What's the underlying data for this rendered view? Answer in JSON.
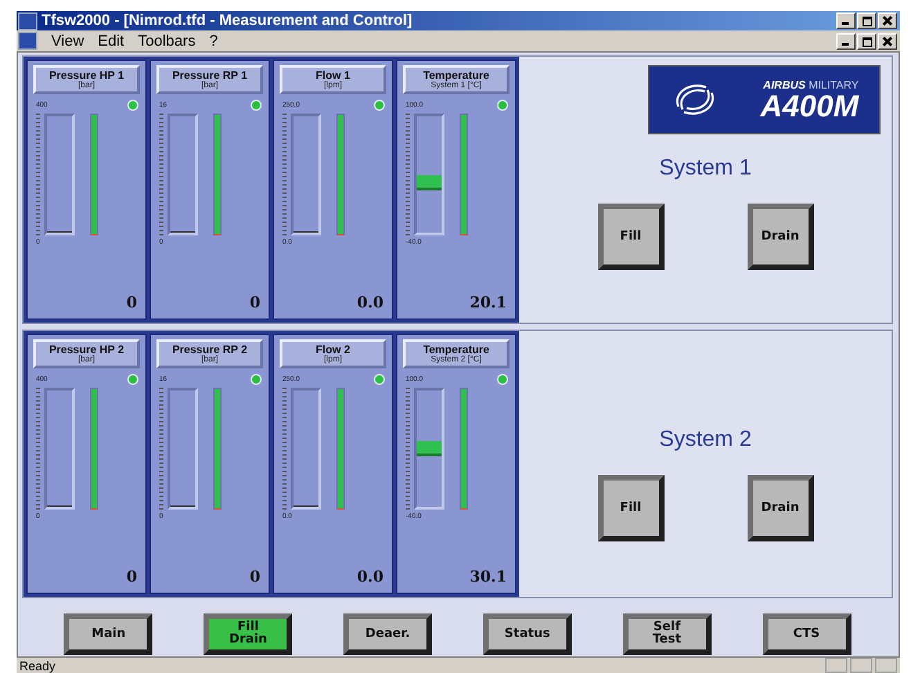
{
  "window": {
    "title": "Tfsw2000 - [Nimrod.tfd - Measurement and Control]"
  },
  "menu": [
    {
      "label": "View"
    },
    {
      "label": "Edit"
    },
    {
      "label": "Toolbars"
    },
    {
      "label": "?"
    }
  ],
  "logo": {
    "brand": "AIRBUS",
    "sub": "MILITARY",
    "model": "A400M"
  },
  "systems": [
    {
      "label": "System 1",
      "buttons": [
        "Fill",
        "Drain"
      ],
      "gauges": [
        {
          "title": "Pressure HP 1",
          "unit": "[bar]",
          "max": "400",
          "min": "0",
          "kind": "line",
          "level": 0,
          "value": "0"
        },
        {
          "title": "Pressure RP 1",
          "unit": "[bar]",
          "max": "16",
          "min": "0",
          "kind": "line",
          "level": 0,
          "value": "0"
        },
        {
          "title": "Flow 1",
          "unit": "[lpm]",
          "max": "250.0",
          "min": "0.0",
          "kind": "line",
          "level": 0,
          "value": "0.0"
        },
        {
          "title": "Temperature",
          "unit": "System 1 [°C]",
          "max": "100.0",
          "min": "-40.0",
          "kind": "block",
          "level": 0.43,
          "value": "20.1"
        }
      ]
    },
    {
      "label": "System 2",
      "buttons": [
        "Fill",
        "Drain"
      ],
      "gauges": [
        {
          "title": "Pressure HP 2",
          "unit": "[bar]",
          "max": "400",
          "min": "0",
          "kind": "line",
          "level": 0,
          "value": "0"
        },
        {
          "title": "Pressure RP 2",
          "unit": "[bar]",
          "max": "16",
          "min": "0",
          "kind": "line",
          "level": 0,
          "value": "0"
        },
        {
          "title": "Flow 2",
          "unit": "[lpm]",
          "max": "250.0",
          "min": "0.0",
          "kind": "line",
          "level": 0,
          "value": "0.0"
        },
        {
          "title": "Temperature",
          "unit": "System 2 [°C]",
          "max": "100.0",
          "min": "-40.0",
          "kind": "block",
          "level": 0.5,
          "value": "30.1"
        }
      ]
    }
  ],
  "nav": [
    {
      "label": "Main",
      "selected": false
    },
    {
      "label": "Fill\nDrain",
      "selected": true
    },
    {
      "label": "Deaer.",
      "selected": false
    },
    {
      "label": "Status",
      "selected": false
    },
    {
      "label": "Self\nTest",
      "selected": false
    },
    {
      "label": "CTS",
      "selected": false
    }
  ],
  "status_bar": "Ready"
}
